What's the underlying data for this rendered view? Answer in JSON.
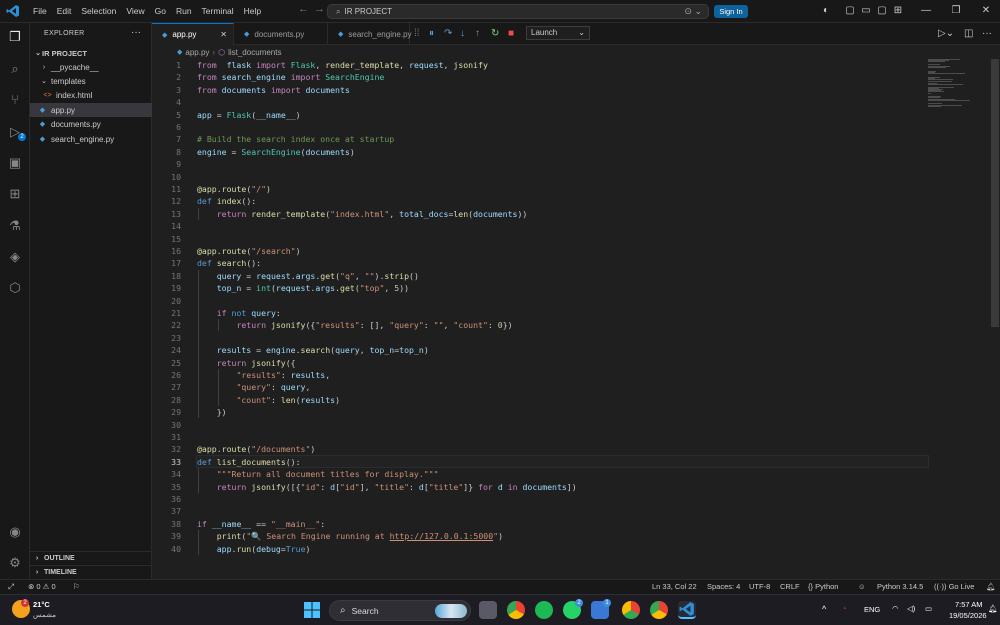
{
  "titlebar": {
    "menus": [
      "File",
      "Edit",
      "Selection",
      "View",
      "Go",
      "Run",
      "Terminal",
      "Help"
    ],
    "search_text": "IR PROJECT",
    "sign_in": "Sign In",
    "launch_config": "Launch"
  },
  "sidebar": {
    "title": "EXPLORER",
    "root": "IR PROJECT",
    "items": [
      {
        "label": "__pycache__",
        "type": "folder"
      },
      {
        "label": "templates",
        "type": "folder"
      },
      {
        "label": "index.html",
        "type": "html"
      },
      {
        "label": "app.py",
        "type": "py"
      },
      {
        "label": "documents.py",
        "type": "py"
      },
      {
        "label": "search_engine.py",
        "type": "py"
      }
    ],
    "outline": "OUTLINE",
    "timeline": "TIMELINE"
  },
  "tabs": [
    "app.py",
    "documents.py",
    "search_engine.py"
  ],
  "breadcrumb": {
    "file": "app.py",
    "symbol": "list_documents"
  },
  "activity_badges": {
    "source_control": "2"
  },
  "code": {
    "line_numbers": [
      "1",
      "2",
      "3",
      "4",
      "5",
      "6",
      "7",
      "8",
      "9",
      "10",
      "11",
      "12",
      "13",
      "14",
      "15",
      "16",
      "17",
      "18",
      "19",
      "20",
      "21",
      "22",
      "23",
      "24",
      "25",
      "26",
      "27",
      "28",
      "29",
      "30",
      "31",
      "32",
      "33",
      "34",
      "35",
      "36",
      "37",
      "38",
      "39",
      "40"
    ],
    "lines": [
      [
        [
          "kw",
          "from"
        ],
        [
          "",
          "  "
        ],
        [
          "var",
          "flask"
        ],
        [
          "",
          " "
        ],
        [
          "kw",
          "import"
        ],
        [
          "",
          " "
        ],
        [
          "cls",
          "Flask"
        ],
        [
          "",
          ", "
        ],
        [
          "fn",
          "render_template"
        ],
        [
          "",
          ", "
        ],
        [
          "var",
          "request"
        ],
        [
          "",
          ", "
        ],
        [
          "fn",
          "jsonify"
        ]
      ],
      [
        [
          "kw",
          "from"
        ],
        [
          "",
          " "
        ],
        [
          "var",
          "search_engine"
        ],
        [
          "",
          " "
        ],
        [
          "kw",
          "import"
        ],
        [
          "",
          " "
        ],
        [
          "cls",
          "SearchEngine"
        ]
      ],
      [
        [
          "kw",
          "from"
        ],
        [
          "",
          " "
        ],
        [
          "var",
          "documents"
        ],
        [
          "",
          " "
        ],
        [
          "kw",
          "import"
        ],
        [
          "",
          " "
        ],
        [
          "var",
          "documents"
        ]
      ],
      [],
      [
        [
          "var",
          "app"
        ],
        [
          "",
          " = "
        ],
        [
          "cls",
          "Flask"
        ],
        [
          "",
          "("
        ],
        [
          "var",
          "__name__"
        ],
        [
          "",
          ")"
        ]
      ],
      [],
      [
        [
          "cmt",
          "# Build the search index once at startup"
        ]
      ],
      [
        [
          "var",
          "engine"
        ],
        [
          "",
          " = "
        ],
        [
          "cls",
          "SearchEngine"
        ],
        [
          "",
          "("
        ],
        [
          "var",
          "documents"
        ],
        [
          "",
          ")"
        ]
      ],
      [],
      [],
      [
        [
          "deco",
          "@app"
        ],
        [
          "",
          "."
        ],
        [
          "fn",
          "route"
        ],
        [
          "",
          "("
        ],
        [
          "str",
          "\"/\""
        ],
        [
          "",
          ")"
        ]
      ],
      [
        [
          "kwb",
          "def"
        ],
        [
          "",
          " "
        ],
        [
          "fn",
          "index"
        ],
        [
          "",
          "():"
        ]
      ],
      [
        [
          "",
          "    "
        ],
        [
          "kw",
          "return"
        ],
        [
          "",
          " "
        ],
        [
          "fn",
          "render_template"
        ],
        [
          "",
          "("
        ],
        [
          "str",
          "\"index.html\""
        ],
        [
          "",
          ", "
        ],
        [
          "var",
          "total_docs"
        ],
        [
          "",
          "="
        ],
        [
          "fn",
          "len"
        ],
        [
          "",
          "("
        ],
        [
          "var",
          "documents"
        ],
        [
          "",
          "))"
        ]
      ],
      [],
      [],
      [
        [
          "deco",
          "@app"
        ],
        [
          "",
          "."
        ],
        [
          "fn",
          "route"
        ],
        [
          "",
          "("
        ],
        [
          "str",
          "\"/search\""
        ],
        [
          "",
          ")"
        ]
      ],
      [
        [
          "kwb",
          "def"
        ],
        [
          "",
          " "
        ],
        [
          "fn",
          "search"
        ],
        [
          "",
          "():"
        ]
      ],
      [
        [
          "",
          "    "
        ],
        [
          "var",
          "query"
        ],
        [
          "",
          " = "
        ],
        [
          "var",
          "request"
        ],
        [
          "",
          "."
        ],
        [
          "var",
          "args"
        ],
        [
          "",
          "."
        ],
        [
          "fn",
          "get"
        ],
        [
          "",
          "("
        ],
        [
          "str",
          "\"q\""
        ],
        [
          "",
          ", "
        ],
        [
          "str",
          "\"\""
        ],
        [
          "",
          ")."
        ],
        [
          "fn",
          "strip"
        ],
        [
          "",
          "()"
        ]
      ],
      [
        [
          "",
          "    "
        ],
        [
          "var",
          "top_n"
        ],
        [
          "",
          " = "
        ],
        [
          "cls",
          "int"
        ],
        [
          "",
          "("
        ],
        [
          "var",
          "request"
        ],
        [
          "",
          "."
        ],
        [
          "var",
          "args"
        ],
        [
          "",
          "."
        ],
        [
          "fn",
          "get"
        ],
        [
          "",
          "("
        ],
        [
          "str",
          "\"top\""
        ],
        [
          "",
          ", "
        ],
        [
          "num",
          "5"
        ],
        [
          "",
          "))"
        ]
      ],
      [],
      [
        [
          "",
          "    "
        ],
        [
          "kw",
          "if"
        ],
        [
          "",
          " "
        ],
        [
          "kwb",
          "not"
        ],
        [
          "",
          " "
        ],
        [
          "var",
          "query"
        ],
        [
          "",
          ":"
        ]
      ],
      [
        [
          "",
          "        "
        ],
        [
          "kw",
          "return"
        ],
        [
          "",
          " "
        ],
        [
          "fn",
          "jsonify"
        ],
        [
          "",
          "({"
        ],
        [
          "str",
          "\"results\""
        ],
        [
          "",
          ": [], "
        ],
        [
          "str",
          "\"query\""
        ],
        [
          "",
          ": "
        ],
        [
          "str",
          "\"\""
        ],
        [
          "",
          ", "
        ],
        [
          "str",
          "\"count\""
        ],
        [
          "",
          ": "
        ],
        [
          "num",
          "0"
        ],
        [
          "",
          "})"
        ]
      ],
      [],
      [
        [
          "",
          "    "
        ],
        [
          "var",
          "results"
        ],
        [
          "",
          " = "
        ],
        [
          "var",
          "engine"
        ],
        [
          "",
          "."
        ],
        [
          "fn",
          "search"
        ],
        [
          "",
          "("
        ],
        [
          "var",
          "query"
        ],
        [
          "",
          ", "
        ],
        [
          "var",
          "top_n"
        ],
        [
          "",
          "="
        ],
        [
          "var",
          "top_n"
        ],
        [
          "",
          ")"
        ]
      ],
      [
        [
          "",
          "    "
        ],
        [
          "kw",
          "return"
        ],
        [
          "",
          " "
        ],
        [
          "fn",
          "jsonify"
        ],
        [
          "",
          "({"
        ]
      ],
      [
        [
          "",
          "        "
        ],
        [
          "str",
          "\"results\""
        ],
        [
          "",
          ": "
        ],
        [
          "var",
          "results"
        ],
        [
          "",
          ","
        ]
      ],
      [
        [
          "",
          "        "
        ],
        [
          "str",
          "\"query\""
        ],
        [
          "",
          ": "
        ],
        [
          "var",
          "query"
        ],
        [
          "",
          ","
        ]
      ],
      [
        [
          "",
          "        "
        ],
        [
          "str",
          "\"count\""
        ],
        [
          "",
          ": "
        ],
        [
          "fn",
          "len"
        ],
        [
          "",
          "("
        ],
        [
          "var",
          "results"
        ],
        [
          "",
          ")"
        ]
      ],
      [
        [
          "",
          "    "
        ],
        [
          "",
          "})"
        ]
      ],
      [],
      [],
      [
        [
          "deco",
          "@app"
        ],
        [
          "",
          "."
        ],
        [
          "fn",
          "route"
        ],
        [
          "",
          "("
        ],
        [
          "str",
          "\"/documents\""
        ],
        [
          "",
          ")"
        ]
      ],
      [
        [
          "kwb",
          "def"
        ],
        [
          "",
          " "
        ],
        [
          "fn",
          "list_documents"
        ],
        [
          "",
          "():"
        ]
      ],
      [
        [
          "",
          "    "
        ],
        [
          "str",
          "\"\"\"Return all document titles for display.\"\"\""
        ]
      ],
      [
        [
          "",
          "    "
        ],
        [
          "kw",
          "return"
        ],
        [
          "",
          " "
        ],
        [
          "fn",
          "jsonify"
        ],
        [
          "",
          "([{"
        ],
        [
          "str",
          "\"id\""
        ],
        [
          "",
          ": "
        ],
        [
          "var",
          "d"
        ],
        [
          "",
          "["
        ],
        [
          "str",
          "\"id\""
        ],
        [
          "",
          "], "
        ],
        [
          "str",
          "\"title\""
        ],
        [
          "",
          ": "
        ],
        [
          "var",
          "d"
        ],
        [
          "",
          "["
        ],
        [
          "str",
          "\"title\""
        ],
        [
          "",
          "]} "
        ],
        [
          "kw",
          "for"
        ],
        [
          "",
          " "
        ],
        [
          "var",
          "d"
        ],
        [
          "",
          " "
        ],
        [
          "kw",
          "in"
        ],
        [
          "",
          " "
        ],
        [
          "var",
          "documents"
        ],
        [
          "",
          "])"
        ]
      ],
      [],
      [],
      [
        [
          "kw",
          "if"
        ],
        [
          "",
          " "
        ],
        [
          "var",
          "__name__"
        ],
        [
          "",
          " == "
        ],
        [
          "str",
          "\"__main__\""
        ],
        [
          "",
          ":"
        ]
      ],
      [
        [
          "",
          "    "
        ],
        [
          "fn",
          "print"
        ],
        [
          "",
          "("
        ],
        [
          "str",
          "\"🔍 Search Engine running at "
        ],
        [
          "link",
          "http://127.0.0.1:5000"
        ],
        [
          "str",
          "\""
        ],
        [
          "",
          ")"
        ]
      ],
      [
        [
          "",
          "    "
        ],
        [
          "var",
          "app"
        ],
        [
          "",
          "."
        ],
        [
          "fn",
          "run"
        ],
        [
          "",
          "("
        ],
        [
          "var",
          "debug"
        ],
        [
          "",
          "="
        ],
        [
          "kwb",
          "True"
        ],
        [
          "",
          ")"
        ]
      ]
    ]
  },
  "statusbar": {
    "problems": "0",
    "warnings": "0",
    "position": "Ln 33, Col 22",
    "spaces": "Spaces: 4",
    "encoding": "UTF-8",
    "eol": "CRLF",
    "language": "Python",
    "interpreter": "Python 3.14.5",
    "go_live": "Go Live"
  },
  "taskbar": {
    "weather_temp": "21°C",
    "weather_desc": "مشمس",
    "weather_badge": "2",
    "search": "Search",
    "whatsapp_badge": "2",
    "app_badge": "1",
    "language": "ENG",
    "time": "7:57 AM",
    "date": "19/05/2026"
  },
  "colors": {
    "accent": "#0078d4",
    "signin": "#0e639c"
  }
}
